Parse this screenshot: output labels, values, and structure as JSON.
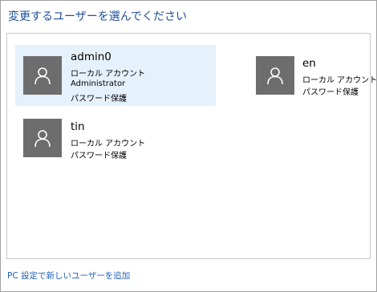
{
  "dialog": {
    "title": "変更するユーザーを選んでください",
    "add_user_link": "PC 設定で新しいユーザーを追加"
  },
  "users": [
    {
      "name": "admin0",
      "type": "ローカル アカウント",
      "role": "Administrator",
      "protection": "パスワード保護",
      "selected": true
    },
    {
      "name": "en",
      "type": "ローカル アカウント",
      "protection": "パスワード保護",
      "selected": false
    },
    {
      "name": "tin",
      "type": "ローカル アカウント",
      "protection": "パスワード保護",
      "selected": false
    }
  ],
  "icons": {
    "avatar": "user-silhouette-icon"
  },
  "colors": {
    "selected_bg": "#e5f1fb",
    "avatar_bg": "#6d6d6d",
    "title": "#1f4e9a",
    "link": "#1f5fb4"
  }
}
